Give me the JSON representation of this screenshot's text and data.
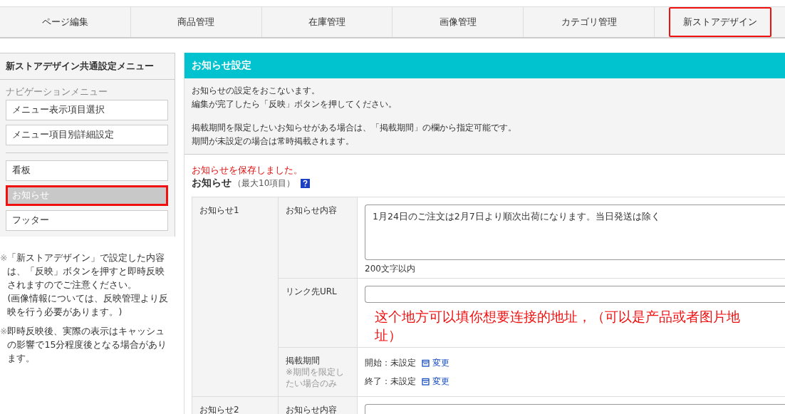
{
  "tabs": [
    {
      "label": "ページ編集",
      "highlighted": false
    },
    {
      "label": "商品管理",
      "highlighted": false
    },
    {
      "label": "在庫管理",
      "highlighted": false
    },
    {
      "label": "画像管理",
      "highlighted": false
    },
    {
      "label": "カテゴリ管理",
      "highlighted": false
    },
    {
      "label": "新ストアデザイン",
      "highlighted": true
    }
  ],
  "sidebar": {
    "title": "新ストアデザイン共通設定メニュー",
    "section_label": "ナビゲーションメニュー",
    "groups": [
      [
        {
          "label": "メニュー表示項目選択",
          "selected": false,
          "highlighted": false
        },
        {
          "label": "メニュー項目別詳細設定",
          "selected": false,
          "highlighted": false
        }
      ],
      [
        {
          "label": "看板",
          "selected": false,
          "highlighted": false
        },
        {
          "label": "お知らせ",
          "selected": true,
          "highlighted": true
        },
        {
          "label": "フッター",
          "selected": false,
          "highlighted": false
        }
      ]
    ],
    "notes": [
      [
        "※",
        "「新ストアデザイン」で設定した内容は、「反映」ボタンを押すと即時反映されますのでご注意ください。",
        "(画像情報については、反映管理より反映を行う必要があります。)"
      ],
      [
        "※",
        "即時反映後、実際の表示はキャッシュの影響で15分程度後となる場合があります。"
      ]
    ]
  },
  "panel": {
    "title": "お知らせ設定",
    "description": [
      [
        "お知らせの設定をおこないます。",
        "編集が完了したら「反映」ボタンを押してください。"
      ],
      [
        "掲載期間を限定したいお知らせがある場合は、「掲載期間」の欄から指定可能です。",
        "期間が未設定の場合は常時掲載されます。"
      ]
    ],
    "saved_message": "お知らせを保存しました。",
    "section_title": "お知らせ",
    "section_hint": "（最大10項目）",
    "notices": [
      {
        "label": "お知らせ1",
        "fields": [
          {
            "kind": "textarea",
            "label": "お知らせ内容",
            "value": "1月24日のご注文は2月7日より順次出荷になります。当日発送は除く",
            "hint": "200文字以内"
          },
          {
            "kind": "url",
            "label": "リンク先URL"
          },
          {
            "kind": "period",
            "label": "掲載期間",
            "note": "※期間を限定したい場合のみ",
            "lines": [
              {
                "label": "開始：未設定",
                "action": "変更"
              },
              {
                "label": "終了：未設定",
                "action": "変更"
              }
            ]
          }
        ]
      },
      {
        "label": "お知らせ2",
        "fields": [
          {
            "kind": "textarea",
            "label": "お知らせ内容"
          }
        ]
      }
    ]
  },
  "annotation": "这个地方可以填你想要连接的地址，（可以是产品或者图片地址）"
}
